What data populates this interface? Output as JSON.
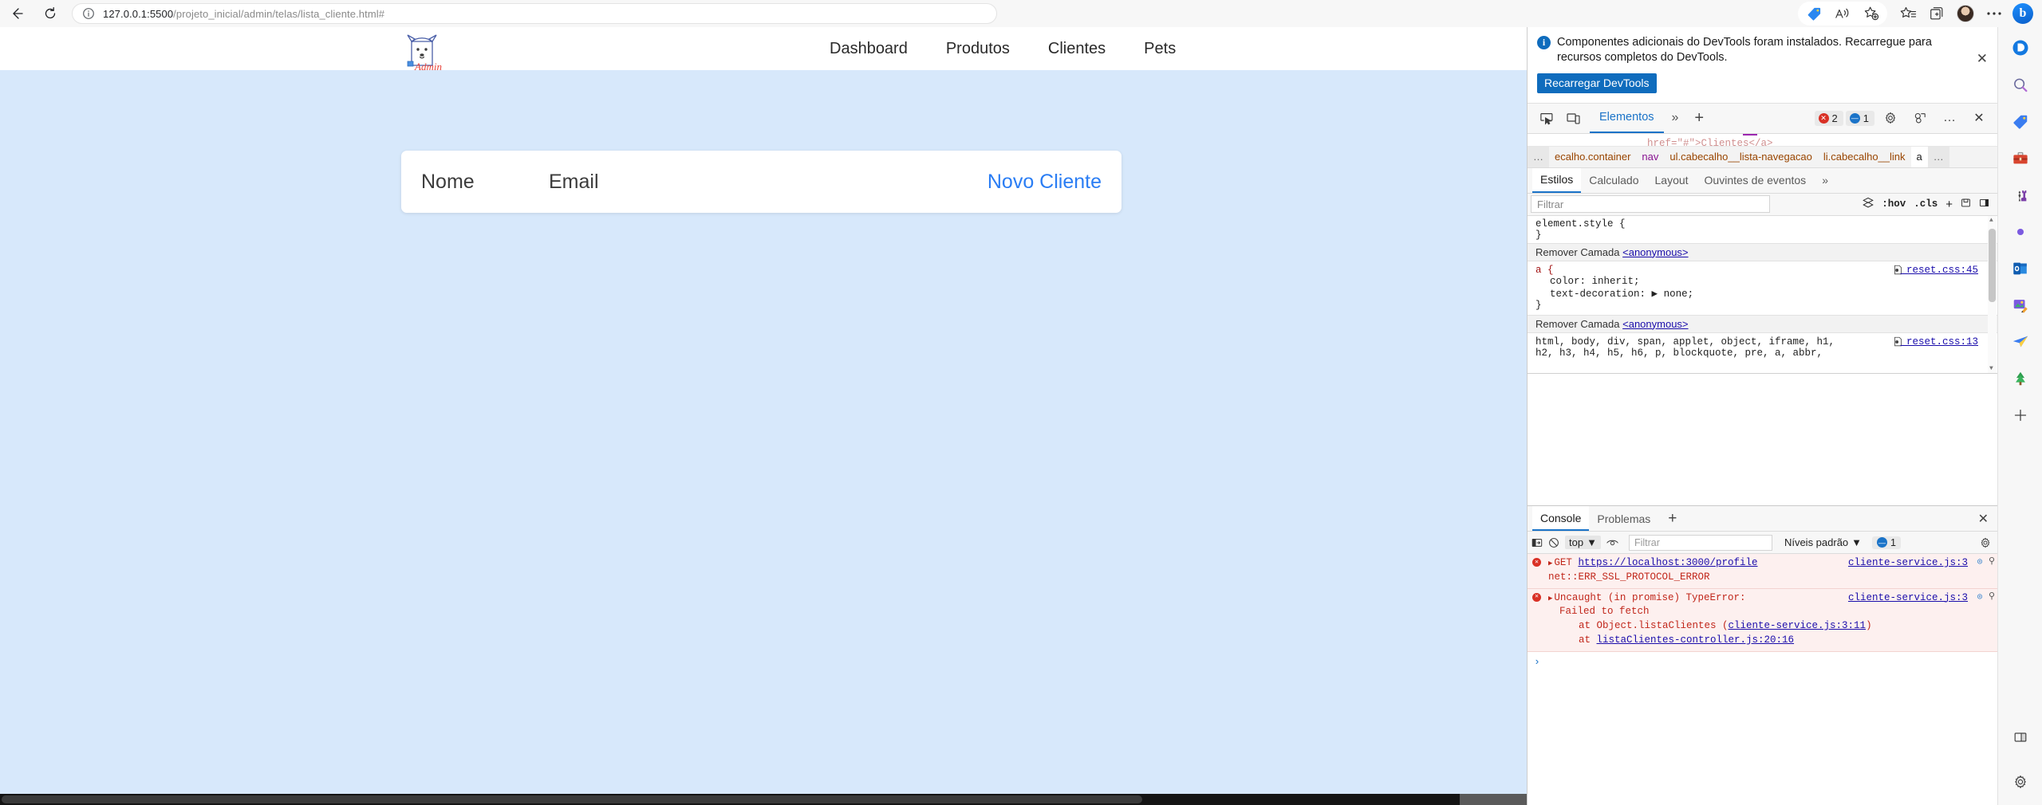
{
  "browser": {
    "back_label": "back-arrow",
    "reload_label": "reload",
    "url_host": "127.0.0.1:5500",
    "url_path": "/projeto_inicial/admin/telas/lista_cliente.html#",
    "url_full": "127.0.0.1:5500/projeto_inicial/admin/telas/lista_cliente.html#"
  },
  "page": {
    "logo_alt": "Admin",
    "logo_caption": "Admin",
    "nav": [
      {
        "label": "Dashboard"
      },
      {
        "label": "Produtos"
      },
      {
        "label": "Clientes"
      },
      {
        "label": "Pets"
      }
    ],
    "card": {
      "col_nome": "Nome",
      "col_email": "Email",
      "action": "Novo Cliente"
    },
    "background_color": "#d7e8fb"
  },
  "devtools": {
    "banner": {
      "message": "Componentes adicionais do DevTools foram instalados. Recarregue para recursos completos do DevTools.",
      "button": "Recarregar DevTools",
      "close": "✕"
    },
    "toolbar": {
      "inspect_icon": "inspect-element-icon",
      "device_icon": "device-toolbar-icon",
      "tab_active": "Elementos",
      "more_tabs": "»",
      "add_tab": "+",
      "error_count": "2",
      "message_count": "1",
      "settings_icon": "gear-icon",
      "customize_icon": "customize-icon",
      "more_icon": "…",
      "close_icon": "✕"
    },
    "breadcrumb": {
      "ellipsis_left": "…",
      "items": [
        {
          "text": "ecalho.container",
          "tag": "",
          "cls": "ecalho.container"
        },
        {
          "text": "nav",
          "tag": "nav",
          "cls": ""
        },
        {
          "text": "ul.cabecalho__lista-navegacao",
          "tag": "ul",
          "cls": ".cabecalho__lista-navegacao"
        },
        {
          "text": "li.cabecalho__link",
          "tag": "li",
          "cls": ".cabecalho__link"
        },
        {
          "text": "a",
          "tag": "a",
          "cls": ""
        }
      ],
      "ellipsis_right": "…"
    },
    "styles_tabs": [
      {
        "label": "Estilos",
        "active": true
      },
      {
        "label": "Calculado",
        "active": false
      },
      {
        "label": "Layout",
        "active": false
      },
      {
        "label": "Ouvintes de eventos",
        "active": false
      },
      {
        "label": "»",
        "active": false
      }
    ],
    "filter": {
      "placeholder": "Filtrar",
      "value": "Filtrar",
      "hov": ":hov",
      "cls": ".cls",
      "plus": "+",
      "new_style_icon": "new-style-rule-icon",
      "toggle_icon": "toggle-sidebar-icon"
    },
    "styles": {
      "element_style_open": "element.style {",
      "element_style_close": "}",
      "layer1_label": "Remover Camada",
      "layer1_link": "<anonymous>",
      "rule1_selector": "a {",
      "rule1_source": "_reset.css:45",
      "rule1_props": [
        {
          "name": "color",
          "value": "inherit;"
        },
        {
          "name": "text-decoration",
          "value": "▶ none;"
        }
      ],
      "rule1_close": "}",
      "layer2_label": "Remover Camada",
      "layer2_link": "<anonymous>",
      "rule2_selector_line1": "html, body, div, span, applet, object, iframe, h1,",
      "rule2_selector_line2": "h2, h3, h4, h5, h6, p, blockquote, pre, a, abbr,",
      "rule2_source": "_reset.css:13"
    },
    "console": {
      "tabs": [
        {
          "label": "Console",
          "active": true
        },
        {
          "label": "Problemas",
          "active": false
        }
      ],
      "add_tab": "+",
      "close": "✕",
      "sidebar_icon": "console-sidebar-icon",
      "clear_icon": "clear-console-icon",
      "context": "top",
      "eye_icon": "live-expression-icon",
      "filter_placeholder": "Filtrar",
      "levels": "Níveis padrão",
      "message_count": "1",
      "settings_icon": "gear-icon",
      "entries": [
        {
          "method": "GET",
          "url": "https://localhost:3000/profile",
          "detail": "net::ERR_SSL_PROTOCOL_ERROR",
          "source": "cliente-service.js:3"
        },
        {
          "title": "Uncaught (in promise) TypeError:",
          "line2": "Failed to fetch",
          "stack": [
            "at Object.listaClientes (cliente-service.js:3:11)",
            "at listaClientes-controller.js:20:16"
          ],
          "stack_links": [
            {
              "prefix": "at Object.listaClientes (",
              "link": "cliente-service.js:3:11",
              "suffix": ")"
            },
            {
              "prefix": "at ",
              "link": "listaClientes-controller.js:20:16",
              "suffix": ""
            }
          ],
          "source": "cliente-service.js:3"
        }
      ],
      "prompt": "›"
    }
  },
  "edge_sidebar": {
    "icons": [
      {
        "name": "copilot-icon",
        "glyph": "ⓑ"
      },
      {
        "name": "search-icon",
        "glyph": "🔍"
      },
      {
        "name": "shopping-tag-icon",
        "glyph": "🏷"
      },
      {
        "name": "tools-briefcase-icon",
        "glyph": "🧰"
      },
      {
        "name": "games-icon",
        "glyph": "♟"
      },
      {
        "name": "microsoft-365-icon",
        "glyph": "◐"
      },
      {
        "name": "outlook-icon",
        "glyph": "✉"
      },
      {
        "name": "image-creator-icon",
        "glyph": "🖼"
      },
      {
        "name": "designer-icon",
        "glyph": "➤"
      },
      {
        "name": "tree-icon",
        "glyph": "🌲"
      },
      {
        "name": "add-sidebar-icon",
        "glyph": "+"
      }
    ],
    "bottom_icons": [
      {
        "name": "split-screen-icon",
        "glyph": "◫"
      },
      {
        "name": "sidebar-settings-icon",
        "glyph": "⚙"
      }
    ]
  },
  "chrome_right": {
    "icons": [
      {
        "name": "shopping-tag-icon"
      },
      {
        "name": "read-aloud-icon"
      },
      {
        "name": "add-favorite-icon"
      },
      {
        "name": "favorites-icon"
      },
      {
        "name": "collections-icon"
      },
      {
        "name": "profile-avatar"
      },
      {
        "name": "settings-more-icon"
      },
      {
        "name": "copilot-bing-icon"
      }
    ]
  }
}
